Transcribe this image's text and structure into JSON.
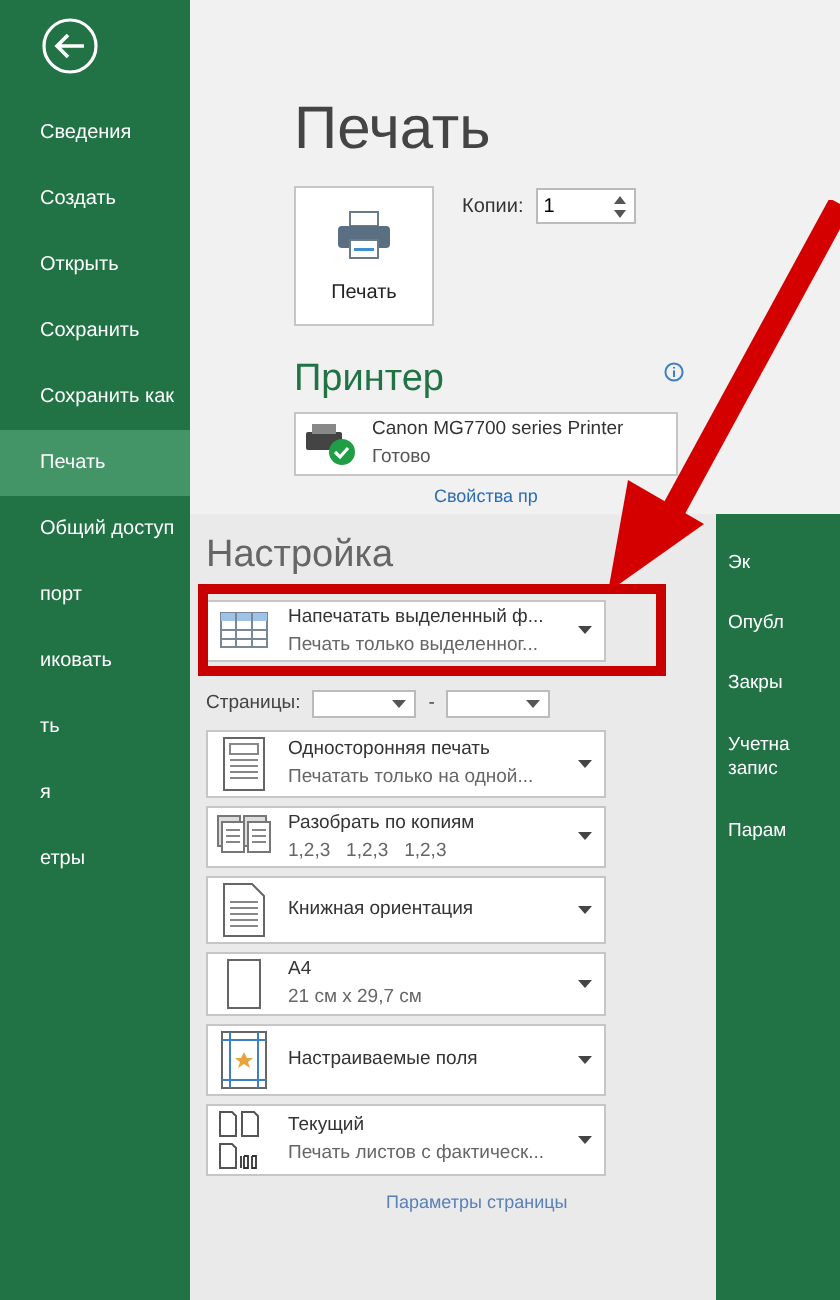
{
  "sidebar": {
    "items": [
      {
        "label": "Сведения",
        "selected": false
      },
      {
        "label": "Создать",
        "selected": false
      },
      {
        "label": "Открыть",
        "selected": false
      },
      {
        "label": "Сохранить",
        "selected": false
      },
      {
        "label": "Сохранить как",
        "selected": false
      },
      {
        "label": "Печать",
        "selected": true
      },
      {
        "label": "Общий доступ",
        "selected": false
      },
      {
        "label": "порт",
        "selected": false
      },
      {
        "label": "иковать",
        "selected": false
      },
      {
        "label": "ть",
        "selected": false
      },
      {
        "label": "я",
        "selected": false
      },
      {
        "label": "етры",
        "selected": false
      }
    ]
  },
  "title": "Печать",
  "print_button": {
    "label": "Печать"
  },
  "copies": {
    "label": "Копии:",
    "value": "1"
  },
  "printer": {
    "heading": "Принтер",
    "name": "Canon MG7700 series Printer",
    "status": "Готово",
    "link": "Свойства пр"
  },
  "settings": {
    "heading": "Настройка",
    "selection": {
      "title": "Напечатать выделенный ф...",
      "subtitle": "Печать только выделенног..."
    },
    "pages": {
      "label": "Страницы:",
      "separator": "-"
    },
    "options": [
      {
        "kind": "sides",
        "title": "Односторонняя печать",
        "subtitle": "Печатать только на одной..."
      },
      {
        "kind": "collate",
        "title": "Разобрать по копиям",
        "subtitle": "1,2,3   1,2,3   1,2,3"
      },
      {
        "kind": "orientation",
        "title": "Книжная ориентация"
      },
      {
        "kind": "paper",
        "title": "A4",
        "subtitle": "21 см x 29,7 см"
      },
      {
        "kind": "margins",
        "title": "Настраиваемые поля"
      },
      {
        "kind": "scaling",
        "title": "Текущий",
        "subtitle": "Печать листов с фактическ..."
      }
    ],
    "link": "Параметры страницы"
  },
  "right_panel": {
    "items": [
      "Эк",
      "Опубл",
      "Закры",
      "Учетна запис",
      "Парам"
    ]
  }
}
